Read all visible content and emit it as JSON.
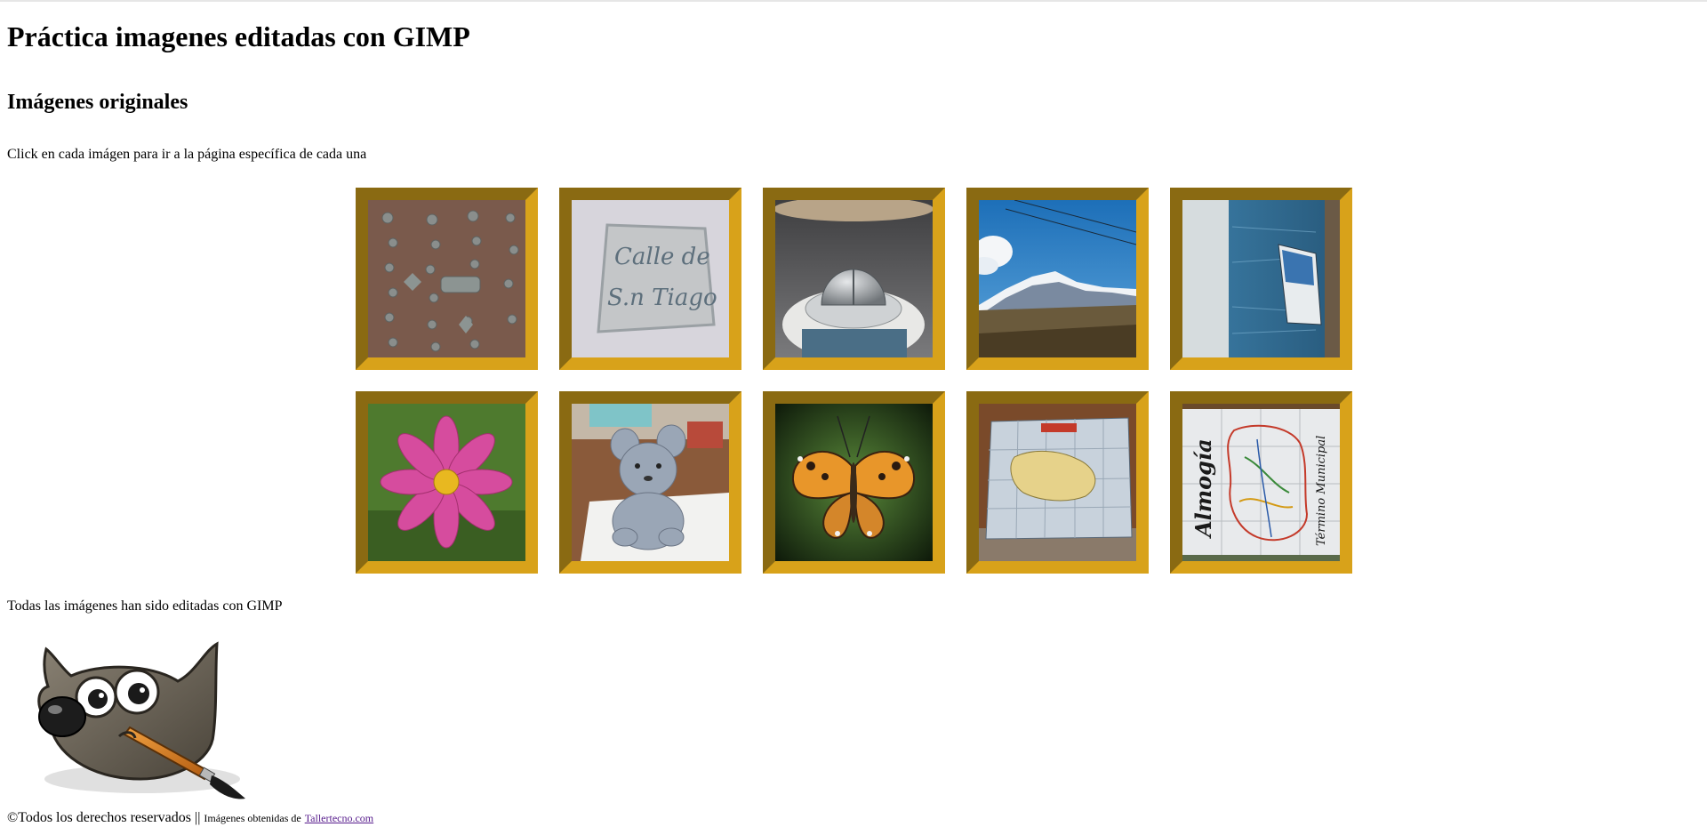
{
  "title": "Práctica imagenes editadas con GIMP",
  "subtitle": "Imágenes originales",
  "intro": "Click en cada imágen para ir a la página específica de cada una",
  "gallery": {
    "images": [
      {
        "name": "door-studs-photo"
      },
      {
        "name": "calle-de-santiago-sign-photo",
        "text1": "Calle de",
        "text2": "S.n Tiago"
      },
      {
        "name": "observatory-dome-photo"
      },
      {
        "name": "snowy-mountains-photo"
      },
      {
        "name": "boat-on-sea-photo"
      },
      {
        "name": "pink-cosmos-flower-photo"
      },
      {
        "name": "plush-toy-photo"
      },
      {
        "name": "butterfly-photo"
      },
      {
        "name": "tile-map-photo"
      },
      {
        "name": "almogia-municipal-map-photo",
        "text1": "Almogía",
        "text2": "Término Municipal"
      }
    ]
  },
  "outro": "Todas las imágenes han sido editadas con GIMP",
  "footer": {
    "copyright": "©Todos los derechos reservados ||",
    "source_prefix": "Imágenes obtenidas de",
    "source_link": "Tallertecno.com"
  },
  "colors": {
    "frame_gold": "#d49a14",
    "frame_dark": "#8a6a12",
    "link_visited": "#551a8b"
  }
}
